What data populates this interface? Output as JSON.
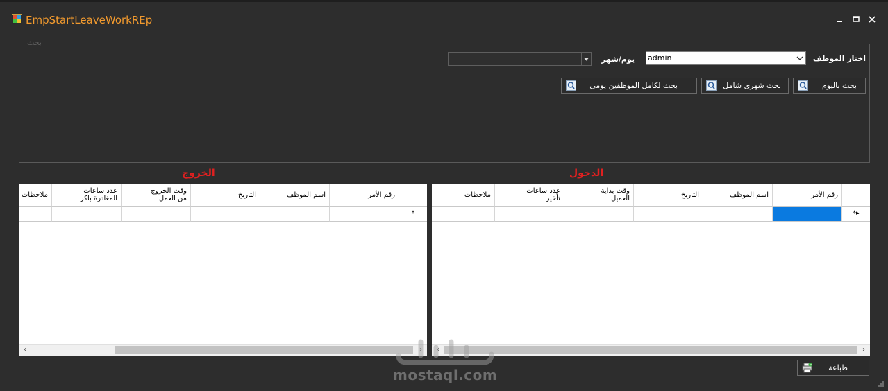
{
  "window": {
    "title": "EmpStartLeaveWorkREp"
  },
  "search_group": {
    "legend": "بحث",
    "employee_label": "اختار الموظف",
    "employee_value": "admin",
    "daymonth_label": "يوم/شهر",
    "daymonth_value": "",
    "buttons": {
      "search_by_day": "بحث باليوم",
      "search_monthly_full": "بحث شهرى شامل",
      "search_all_employees_daily": "بحث لكامل الموظفين يومى"
    }
  },
  "entry_section": {
    "title": "الدخول",
    "columns": [
      "رقم الأمر",
      "اسم الموظف",
      "التاريخ",
      "وقت بداية\nالعميل",
      "عدد ساعات\nتأخير",
      "ملاحظات"
    ],
    "new_row_indicator": "▸*"
  },
  "exit_section": {
    "title": "الخروج",
    "columns": [
      "رقم الأمر",
      "اسم الموظف",
      "التاريخ",
      "وقت الخروج\nمن العمل",
      "عدد ساعات\nالمغادرة باكر",
      "ملاحظات"
    ],
    "new_row_indicator": "*"
  },
  "footer": {
    "print_label": "طباعة",
    "watermark": "mostaql.com"
  },
  "colors": {
    "window_bg": "#2d2d2d",
    "title_orange": "#f29a2e",
    "section_red": "#e02020",
    "selection_blue": "#0a7ae0"
  }
}
